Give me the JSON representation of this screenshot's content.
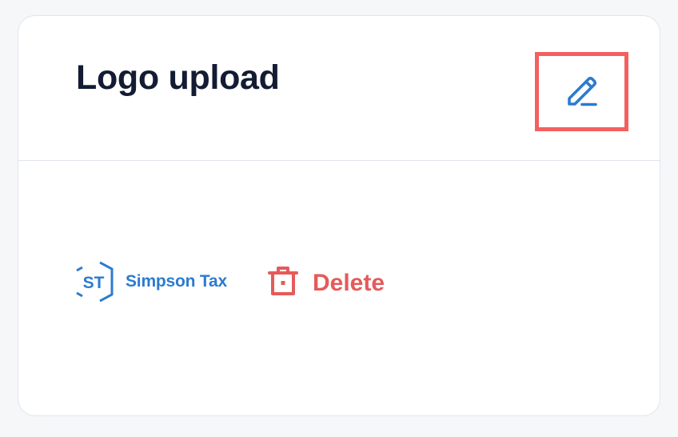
{
  "card": {
    "title": "Logo upload",
    "edit_icon": "pencil-edit-icon"
  },
  "logo": {
    "initials": "ST",
    "name": "Simpson Tax",
    "brand_color": "#2c7bd0"
  },
  "delete": {
    "label": "Delete",
    "icon": "trash-icon",
    "color": "#e65a5a"
  },
  "colors": {
    "title": "#131c33",
    "accent": "#2c7bd0",
    "highlight_border": "#f45f5f",
    "divider": "#e0e5ec"
  }
}
